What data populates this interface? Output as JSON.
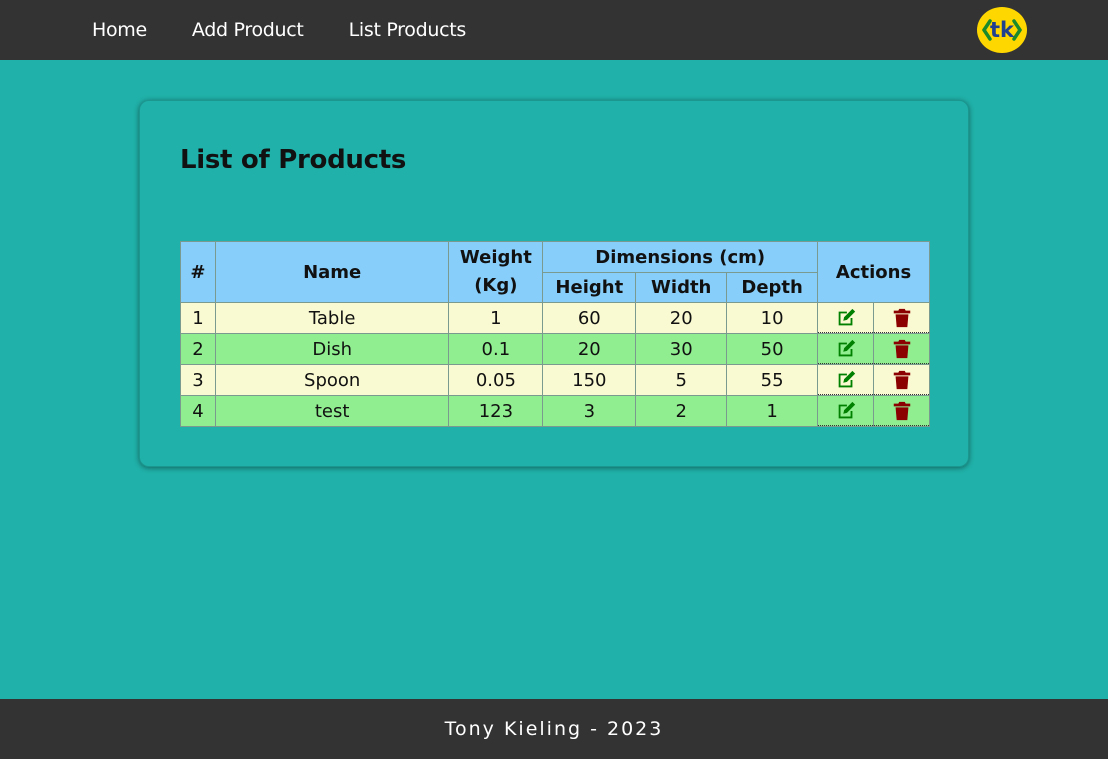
{
  "nav": {
    "items": [
      {
        "label": "Home"
      },
      {
        "label": "Add Product"
      },
      {
        "label": "List Products"
      }
    ],
    "logo_text": "tk"
  },
  "main": {
    "title": "List of Products",
    "table": {
      "headers": {
        "index": "#",
        "name": "Name",
        "weight": "Weight (Kg)",
        "dimensions": "Dimensions (cm)",
        "height": "Height",
        "width": "Width",
        "depth": "Depth",
        "actions": "Actions"
      },
      "rows": [
        {
          "index": "1",
          "name": "Table",
          "weight": "1",
          "height": "60",
          "width": "20",
          "depth": "10"
        },
        {
          "index": "2",
          "name": "Dish",
          "weight": "0.1",
          "height": "20",
          "width": "30",
          "depth": "50"
        },
        {
          "index": "3",
          "name": "Spoon",
          "weight": "0.05",
          "height": "150",
          "width": "5",
          "depth": "55"
        },
        {
          "index": "4",
          "name": "test",
          "weight": "123",
          "height": "3",
          "width": "2",
          "depth": "1"
        }
      ]
    }
  },
  "footer": {
    "text": "Tony Kieling - 2023"
  },
  "colors": {
    "background": "#20b2aa",
    "bar": "#333333",
    "header_cell": "#87cefa",
    "row_odd": "#fafad2",
    "row_even": "#90ee90",
    "edit_icon": "#008000",
    "delete_icon": "#8b0000",
    "logo_fill": "#ffd700",
    "logo_text": "#1f3f8f"
  },
  "icons": {
    "edit": "edit-icon",
    "delete": "trash-icon"
  }
}
